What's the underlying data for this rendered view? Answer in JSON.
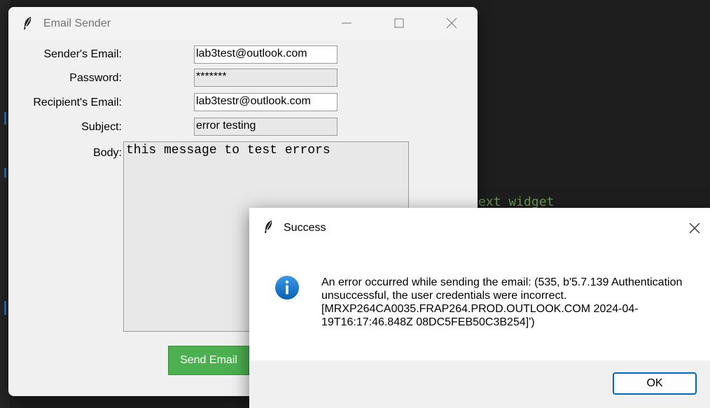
{
  "background": {
    "code_fragment": "ext widget"
  },
  "window": {
    "title": "Email Sender",
    "icon": "feather-icon"
  },
  "form": {
    "sender_label": "Sender's Email:",
    "sender_value": "lab3test@outlook.com",
    "password_label": "Password:",
    "password_value": "*******",
    "recipient_label": "Recipient's Email:",
    "recipient_value": "lab3testr@outlook.com",
    "subject_label": "Subject:",
    "subject_value": "error testing",
    "body_label": "Body:",
    "body_value": "this message to test errors",
    "send_label": "Send Email",
    "send_color": "#4caf50"
  },
  "dialog": {
    "title": "Success",
    "icon": "info-icon",
    "message": "An error occurred while sending the email: (535, b'5.7.139 Authentication unsuccessful, the user credentials were incorrect. [MRXP264CA0035.FRAP264.PROD.OUTLOOK.COM 2024-04-19T16:17:46.848Z 08DC5FEB50C3B254]')",
    "ok_label": "OK",
    "accent_color": "#0067c0"
  }
}
